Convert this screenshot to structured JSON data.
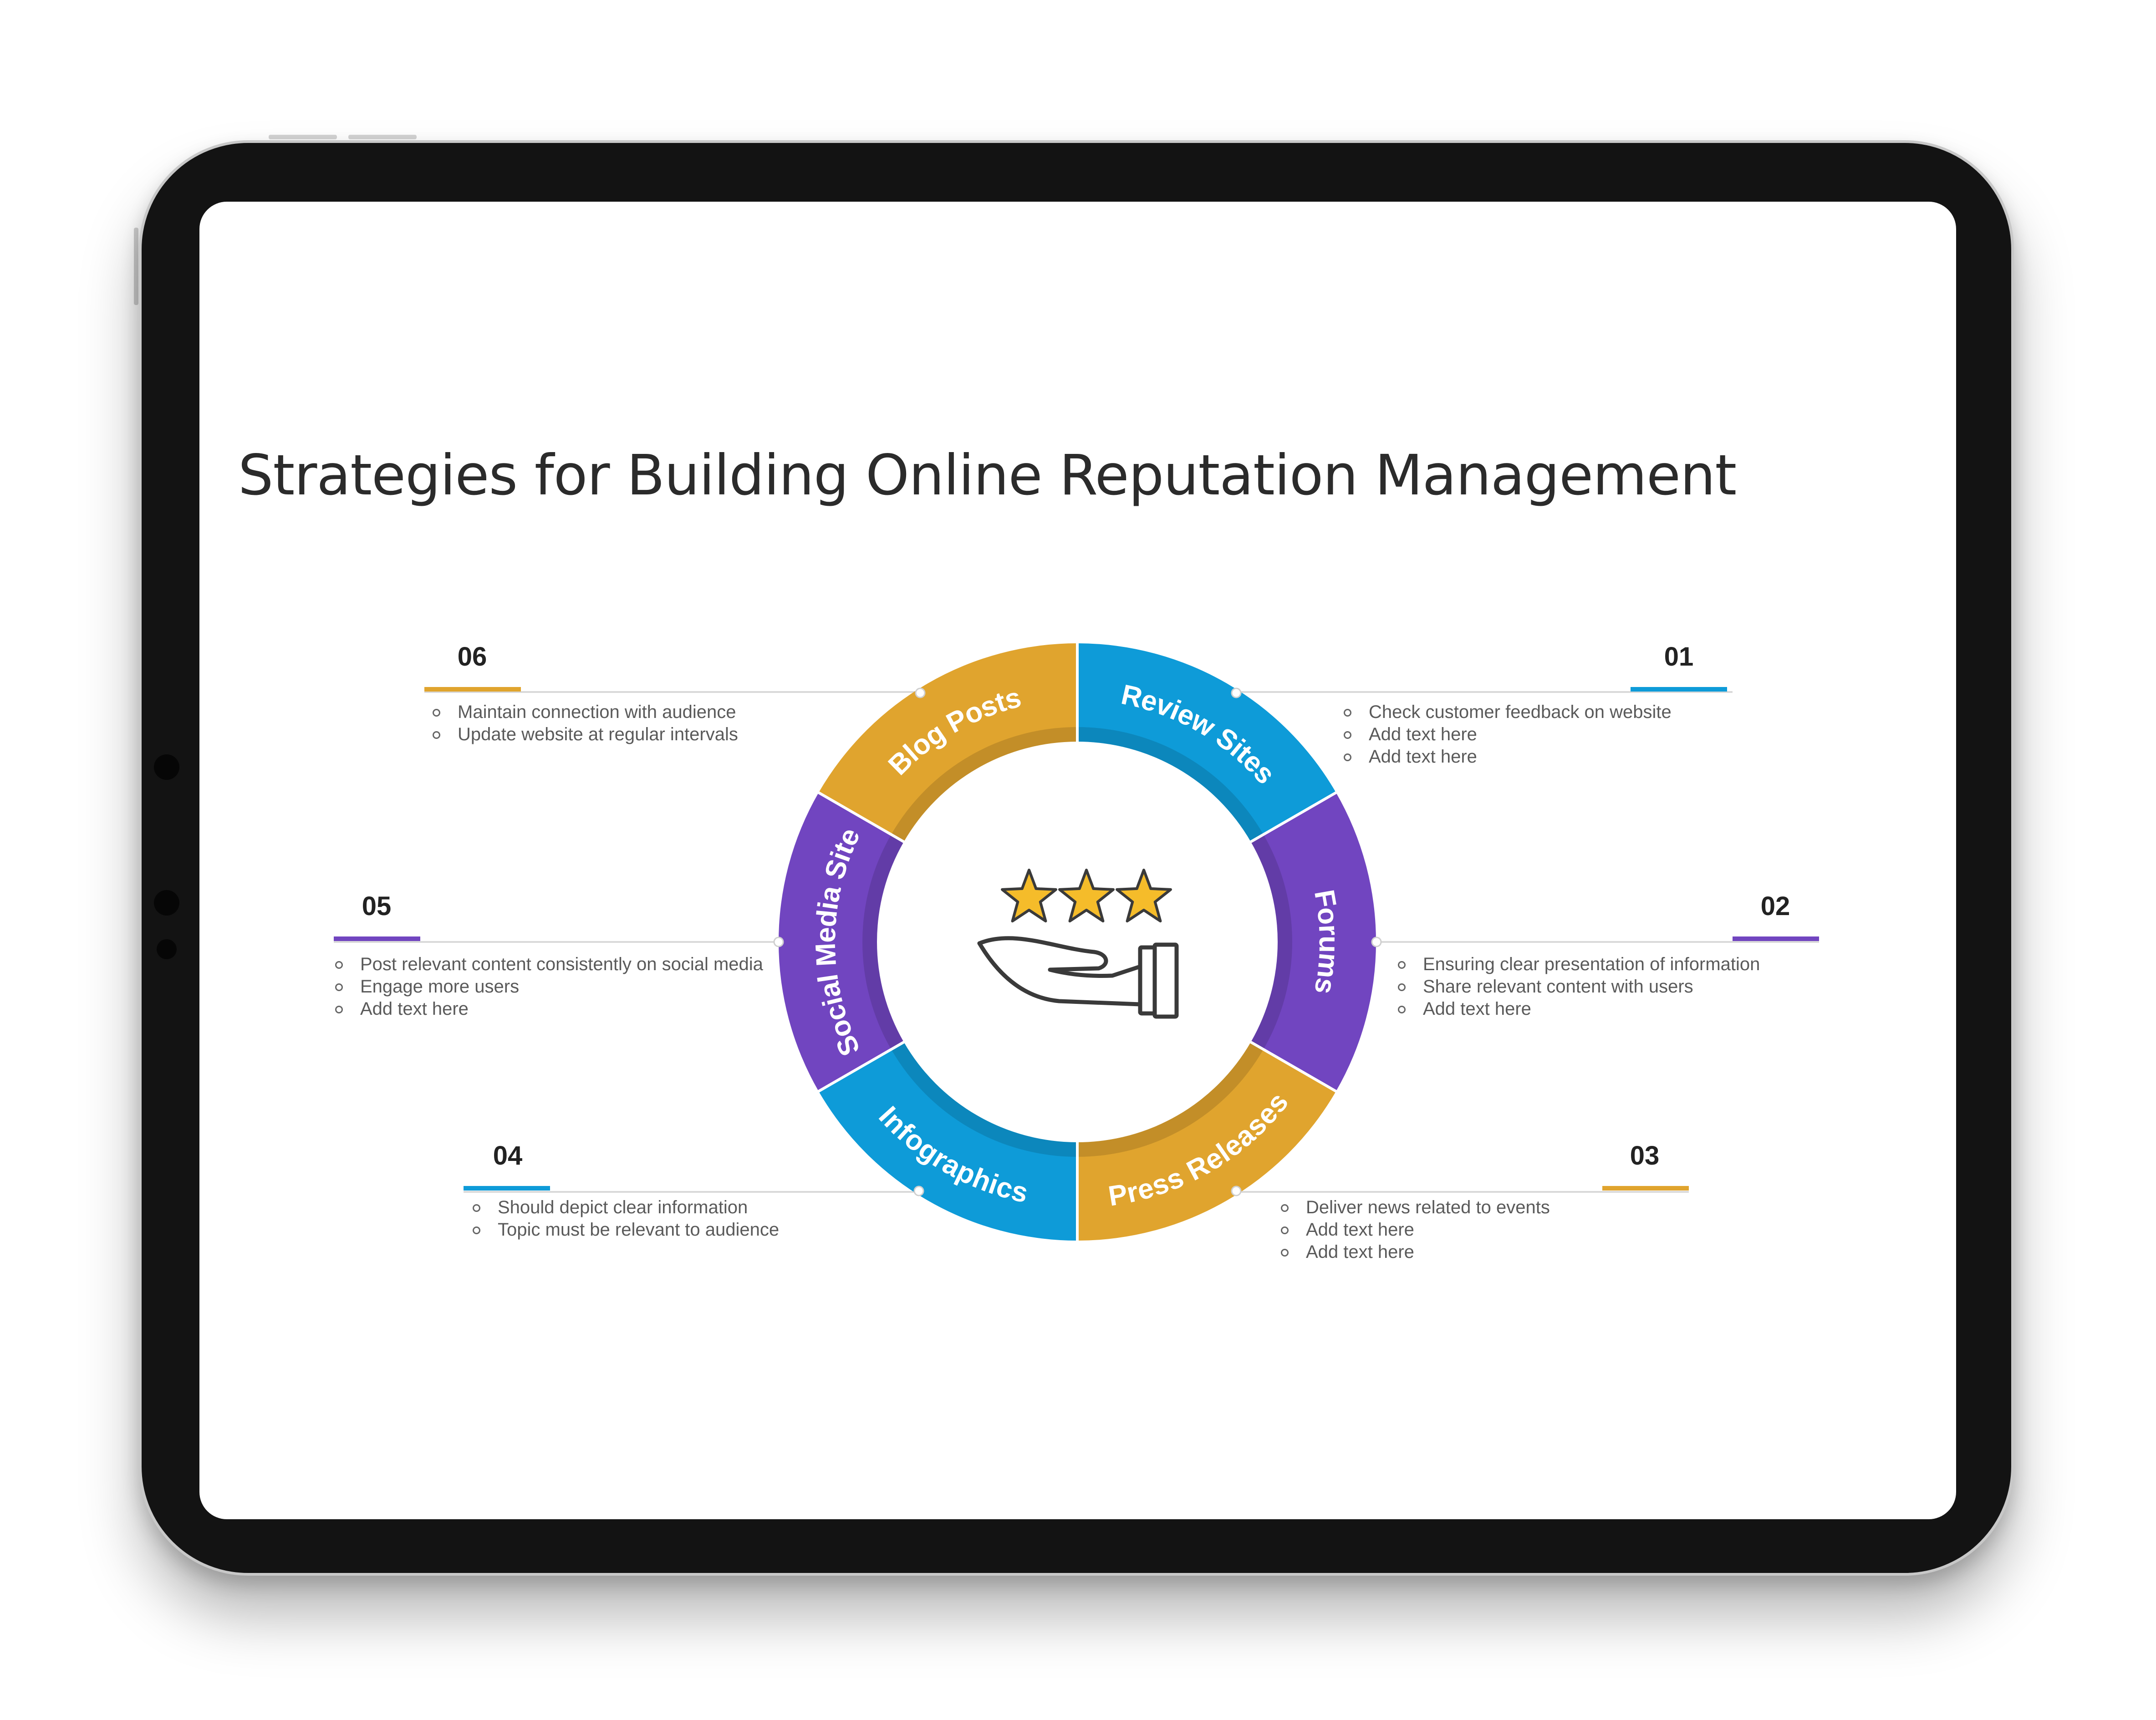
{
  "title": "Strategies  for Building Online Reputation  Management",
  "colors": {
    "gold": "#E0A42E",
    "blue": "#0E9BD8",
    "purple": "#7145C0",
    "star": "#F5BC2A",
    "connector": "#d9d9d9"
  },
  "center_icon": "hand-with-three-stars-icon",
  "segments": [
    {
      "label": "Review Sites",
      "color": "#0E9BD8"
    },
    {
      "label": "Forums",
      "color": "#7145C0"
    },
    {
      "label": "Press Releases",
      "color": "#E0A42E"
    },
    {
      "label": "Infographics",
      "color": "#0E9BD8"
    },
    {
      "label": "Social Media Site",
      "color": "#7145C0"
    },
    {
      "label": "Blog Posts",
      "color": "#E0A42E"
    }
  ],
  "items": [
    {
      "num": "01",
      "color": "#0E9BD8",
      "bullets": [
        "Check customer feedback on website",
        "Add text here",
        "Add text here"
      ]
    },
    {
      "num": "02",
      "color": "#7145C0",
      "bullets": [
        "Ensuring clear presentation  of information",
        "Share relevant  content with users",
        "Add text here"
      ]
    },
    {
      "num": "03",
      "color": "#E0A42E",
      "bullets": [
        "Deliver  news related to events",
        "Add text here",
        "Add text here"
      ]
    },
    {
      "num": "04",
      "color": "#0E9BD8",
      "bullets": [
        "Should depict clear information",
        "Topic  must be relevant  to audience"
      ]
    },
    {
      "num": "05",
      "color": "#7145C0",
      "bullets": [
        "Post relevant  content consistently on social media",
        "Engage more users",
        "Add text here"
      ]
    },
    {
      "num": "06",
      "color": "#E0A42E",
      "bullets": [
        "Maintain connection with audience",
        "Update  website  at regular  intervals"
      ]
    }
  ]
}
